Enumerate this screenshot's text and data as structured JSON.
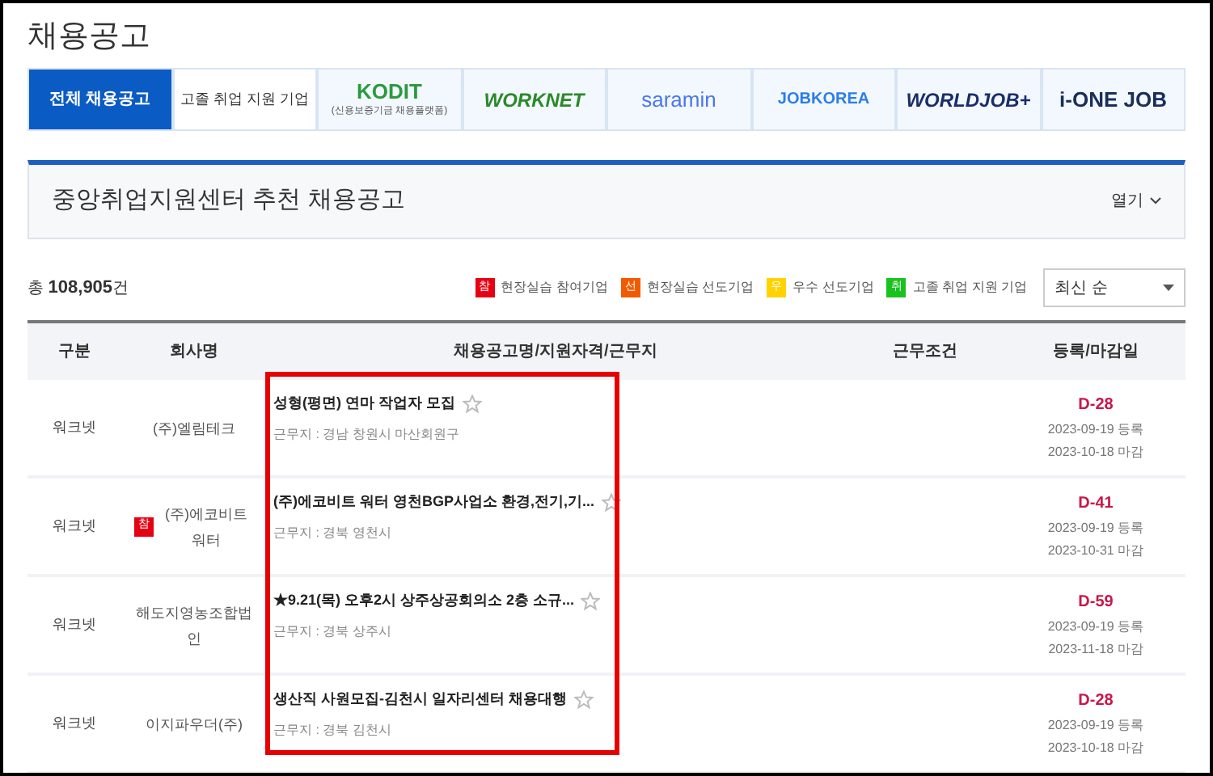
{
  "page_title": "채용공고",
  "tabs": [
    {
      "label": "전체 채용공고",
      "kind": "text",
      "selected": true
    },
    {
      "label": "고졸 취업 지원 기업",
      "kind": "text",
      "selected": false
    },
    {
      "label": "KODIT",
      "sub": "(신용보증기금 채용플랫폼)",
      "kind": "kodit",
      "selected": false
    },
    {
      "label": "WORKNET",
      "kind": "worknet",
      "selected": false
    },
    {
      "label": "saramin",
      "kind": "saramin",
      "selected": false
    },
    {
      "label": "JOBKOREA",
      "kind": "jobkorea",
      "selected": false
    },
    {
      "label": "WORLDJOB+",
      "kind": "worldjob",
      "selected": false
    },
    {
      "label": "i-ONE JOB",
      "kind": "ione",
      "selected": false
    }
  ],
  "section": {
    "title": "중앙취업지원센터 추천 채용공고",
    "toggle": "열기",
    "expanded": false
  },
  "count": {
    "prefix": "총",
    "number": "108,905",
    "suffix": "건"
  },
  "legend": [
    {
      "badge": "참",
      "label": "현장실습 참여기업",
      "color": "#e60012"
    },
    {
      "badge": "선",
      "label": "현장실습 선도기업",
      "color": "#f25a00"
    },
    {
      "badge": "우",
      "label": "우수 선도기업",
      "color": "#ffd200"
    },
    {
      "badge": "취",
      "label": "고졸 취업 지원 기업",
      "color": "#19c31e"
    }
  ],
  "sort": {
    "value": "최신 순"
  },
  "table": {
    "columns": [
      "구분",
      "회사명",
      "채용공고명/지원자격/근무지",
      "근무조건",
      "등록/마감일"
    ],
    "rows": [
      {
        "source": "워크넷",
        "company": "(주)엘림테크",
        "title": "성형(평면) 연마 작업자 모집",
        "location": "근무지 : 경남 창원시 마산회원구",
        "bookmarked": false,
        "dday": "D-28",
        "registered": "2023-09-19 등록",
        "deadline": "2023-10-18 마감"
      },
      {
        "source": "워크넷",
        "badge": "참",
        "color": "#e60012",
        "company": "(주)에코비트워터",
        "title": "(주)에코비트 워터 영천BGP사업소 환경,전기,기...",
        "location": "근무지 : 경북 영천시",
        "bookmarked": false,
        "dday": "D-41",
        "registered": "2023-09-19 등록",
        "deadline": "2023-10-31 마감"
      },
      {
        "source": "워크넷",
        "company": "해도지영농조합법인",
        "title": "★9.21(목) 오후2시 상주상공회의소 2층 소규...",
        "location": "근무지 : 경북 상주시",
        "bookmarked": false,
        "dday": "D-59",
        "registered": "2023-09-19 등록",
        "deadline": "2023-11-18 마감"
      },
      {
        "source": "워크넷",
        "company": "이지파우더(주)",
        "title": "생산직 사원모집-김천시 일자리센터 채용대행",
        "location": "근무지 : 경북 김천시",
        "bookmarked": false,
        "dday": "D-28",
        "registered": "2023-09-19 등록",
        "deadline": "2023-10-18 마감"
      }
    ]
  }
}
